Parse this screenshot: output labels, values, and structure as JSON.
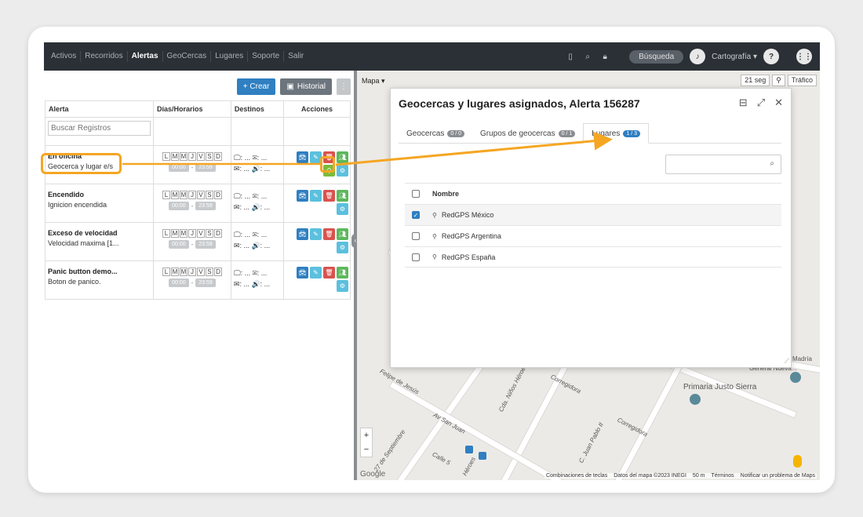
{
  "nav": {
    "links": [
      "Activos",
      "Recorridos",
      "Alertas",
      "GeoCercas",
      "Lugares",
      "Soporte",
      "Salir"
    ],
    "active": "Alertas",
    "search_label": "Búsqueda",
    "cartography_label": "Cartografía ▾",
    "icons": [
      "mobile-icon",
      "search-icon",
      "lock-icon",
      "bell-icon",
      "help-icon",
      "grid-icon"
    ]
  },
  "toolbar": {
    "create_label": "+ Crear",
    "history_label": "Historial"
  },
  "table": {
    "headers": [
      "Alerta",
      "Días/Horarios",
      "Destinos",
      "Acciones"
    ],
    "search_placeholder": "Buscar Registros",
    "days": [
      "L",
      "M",
      "M",
      "J",
      "V",
      "S",
      "D"
    ],
    "time_start": "00:00",
    "time_end": "23:59",
    "time_sep": "-",
    "dest_line1": "🖵: ...  ✉: ...",
    "dest_line2": "✉: ...  🔊: ...",
    "rows": [
      {
        "name": "En oficina",
        "desc": "Geocerca y lugar e/s"
      },
      {
        "name": "Encendido",
        "desc": "Ignicion encendida"
      },
      {
        "name": "Exceso de velocidad",
        "desc": "Velocidad maxima [1..."
      },
      {
        "name": "Panic button demo...",
        "desc": "Boton de panico."
      }
    ]
  },
  "map": {
    "type_label": "Mapa ▾",
    "refresh": "21 seg",
    "traffic": "Tráfico",
    "zoom_in": "+",
    "zoom_out": "−",
    "labels": [
      "Felipe de Jesús",
      "Av San Juan",
      "Cda. Niños Héroes",
      "Corregidora",
      "C. Juan Pablo II",
      "Corregidora",
      "27 de Septiembre",
      "Calle 5",
      "Héroes",
      "Primaria Justo Sierra",
      "General Nueva...",
      "Madría"
    ],
    "attribution": [
      "Combinaciones de teclas",
      "Datos del mapa ©2023 INEGI",
      "50 m",
      "Términos",
      "Notificar un problema de Maps"
    ],
    "google": "Google"
  },
  "dialog": {
    "title": "Geocercas y lugares asignados, Alerta 156287",
    "tabs": [
      {
        "label": "Geocercas",
        "count": "0 / 0"
      },
      {
        "label": "Grupos de geocercas",
        "count": "0 / 1"
      },
      {
        "label": "Lugares",
        "count": "1 / 3"
      }
    ],
    "col_name": "Nombre",
    "places": [
      {
        "name": "RedGPS México",
        "checked": true
      },
      {
        "name": "RedGPS Argentina",
        "checked": false
      },
      {
        "name": "RedGPS España",
        "checked": false
      }
    ]
  },
  "colors": {
    "accent": "#2f7fc1",
    "highlight": "#f5a623",
    "navbar": "#2b3036"
  }
}
